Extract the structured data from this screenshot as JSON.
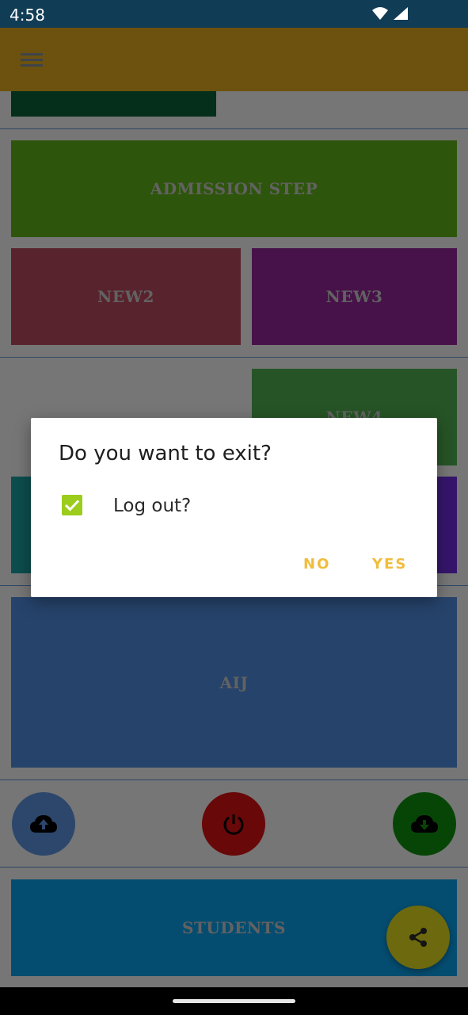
{
  "status_bar": {
    "time": "4:58",
    "icons": [
      "wifi-icon",
      "cell-signal-icon"
    ]
  },
  "app_bar": {
    "color": "#d8a41c",
    "menu_icon": "hamburger-menu-icon"
  },
  "tiles": {
    "admission": "ADMISSION STEP",
    "new2": "NEW2",
    "new3": "NEW3",
    "new4": "NEW4",
    "aij": "AIJ",
    "students": "STUDENTS"
  },
  "fabs": {
    "upload": "cloud-upload-icon",
    "power": "power-icon",
    "download": "cloud-download-icon",
    "share": "share-icon"
  },
  "dialog": {
    "title": "Do you want to exit?",
    "checkbox_label": "Log out?",
    "checkbox_checked": true,
    "no_label": "NO",
    "yes_label": "YES",
    "accent_color": "#f0bd3c"
  }
}
